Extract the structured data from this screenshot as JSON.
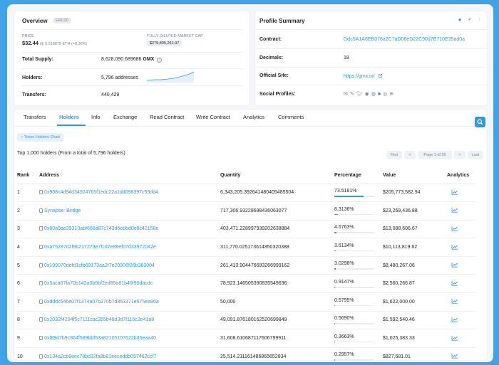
{
  "overview": {
    "title": "Overview",
    "badge": "ERC20",
    "price_label": "PRICE",
    "price": "$32.44",
    "price_sub": "@ 0.018875 ETH (+8.36%)",
    "mcap_label": "FULLY DILUTED MARKET CAP",
    "mcap": "$279,895,261.97",
    "supply_label": "Total Supply:",
    "supply_value": "8,628,090.689686",
    "supply_symbol": "GMX",
    "holders_label": "Holders:",
    "holders_value": "5,796 addresses",
    "transfers_label": "Transfers:",
    "transfers_value": "440,429"
  },
  "profile": {
    "title": "Profile Summary",
    "contract_label": "Contract:",
    "contract_value": "0xfc5A1A6EB076a2C7aD06eD22C90d7E710E35ad0a",
    "decimals_label": "Decimals:",
    "decimals_value": "18",
    "site_label": "Official Site:",
    "site_value": "https://gmx.io/",
    "social_label": "Social Profiles:"
  },
  "tabs": [
    "Transfers",
    "Holders",
    "Info",
    "Exchange",
    "Read Contract",
    "Write Contract",
    "Analytics",
    "Comments"
  ],
  "active_tab": 1,
  "chart_button": "Token Holders Chart",
  "summary": "Top 1,000 holders (From a total of 5,796 holders)",
  "pager": {
    "first": "First",
    "prev": "<",
    "page": "Page 1 of 20",
    "next": ">",
    "last": "Last"
  },
  "columns": [
    "Rank",
    "Address",
    "Quantity",
    "Percentage",
    "Value",
    "Analytics"
  ],
  "rows": [
    {
      "rank": "1",
      "address": "0x908c4d94d34924765f1edc22a1dd098397c59dd4",
      "quantity": "6,343,205.392641480405485504",
      "percentage": "73.5181%",
      "pct": 73.5181,
      "value": "$205,773,582.94"
    },
    {
      "rank": "2",
      "address": "Synapse: Bridge",
      "quantity": "717,306.93228698436063077",
      "percentage": "8.3136%",
      "pct": 8.3136,
      "value": "$23,269,436.88"
    },
    {
      "rank": "3",
      "address": "0x80a9ae39310abf666a87c743d6ebbd0e8c42158e",
      "quantity": "403,471.228997939202638884",
      "percentage": "4.6763%",
      "pct": 4.6763,
      "value": "$13,088,606.67"
    },
    {
      "rank": "4",
      "address": "0xa75287d2f8b217273e7fcd7e86ef07d33972042e",
      "quantity": "311,770.025173614350320388",
      "percentage": "3.6134%",
      "pct": 3.6134,
      "value": "$10,113,819.62"
    },
    {
      "rank": "5",
      "address": "0x199070ddfd1cfb69173aa2f7e20906f26b363004",
      "quantity": "261,413.904476693266999162",
      "percentage": "3.0298%",
      "pct": 3.0298,
      "value": "$8,480,267.06"
    },
    {
      "rank": "6",
      "address": "0x5aca67fa70b142a3b9bf2ed89a81b40f95dacdc",
      "quantity": "78,923.146505390835549636",
      "percentage": "0.9147%",
      "pct": 0.9147,
      "value": "$2,560,266.87"
    },
    {
      "rank": "7",
      "address": "0xdddc546e07f1374a07b270b7d863371e575ea96a",
      "quantity": "50,000",
      "percentage": "0.5795%",
      "pct": 0.5795,
      "value": "$1,622,000.00"
    },
    {
      "rank": "8",
      "address": "0x2032f4294f5c7111cac355b48d3d7f116c2e41a8",
      "quantity": "49,091.876180162520699849",
      "percentage": "0.5690%",
      "pct": 0.569,
      "value": "$1,592,540.46"
    },
    {
      "rank": "9",
      "address": "0xf89d7b9c864f589bbf53a82105107622b35eaa40",
      "quantity": "31,608.610687117606799911",
      "percentage": "0.3663%",
      "pct": 0.3663,
      "value": "$1,025,383.33"
    },
    {
      "rank": "10",
      "address": "0x134a2cb9eec78bd32fa8b81eeceddb057462ccf7",
      "quantity": "25,514.211161486865652834",
      "percentage": "0.2957%",
      "pct": 0.2957,
      "value": "$827,681.01"
    }
  ],
  "colors": {
    "accent": "#3498db",
    "background": "#3fa3e8",
    "text": "#1e2022",
    "muted": "#77838f"
  },
  "icons": {
    "price_change": "info-icon",
    "supply_info": "info-icon",
    "site_external": "external-link-icon",
    "socials": [
      "email-icon",
      "pen-icon",
      "twitter-icon",
      "github-icon",
      "reddit-icon",
      "medium-icon",
      "telegram-icon",
      "globe-icon"
    ],
    "analytics": "line-chart-icon",
    "search": "search-icon"
  }
}
